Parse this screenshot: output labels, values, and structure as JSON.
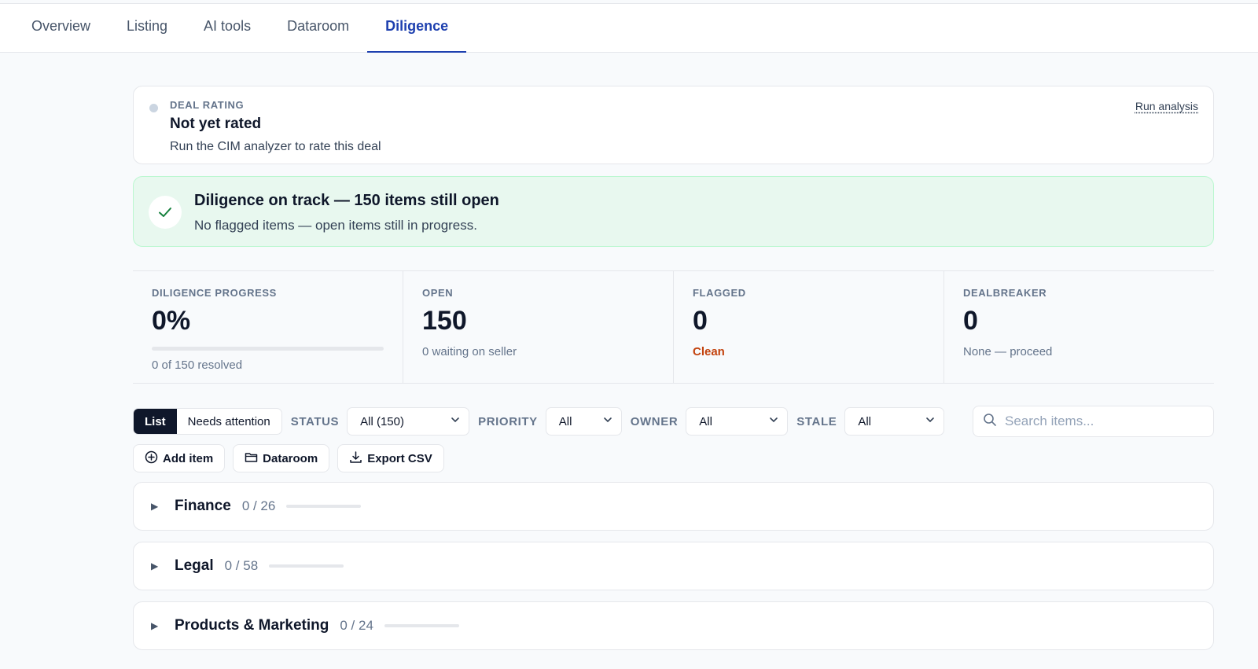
{
  "tabs": [
    {
      "label": "Overview",
      "active": false
    },
    {
      "label": "Listing",
      "active": false
    },
    {
      "label": "AI tools",
      "active": false
    },
    {
      "label": "Dataroom",
      "active": false
    },
    {
      "label": "Diligence",
      "active": true
    }
  ],
  "rating": {
    "eyebrow": "DEAL RATING",
    "title": "Not yet rated",
    "subtitle": "Run the CIM analyzer to rate this deal",
    "action": "Run analysis"
  },
  "banner": {
    "title": "Diligence on track — 150 items still open",
    "subtitle": "No flagged items — open items still in progress.",
    "icon": "check-icon"
  },
  "stats": [
    {
      "label": "DILIGENCE PROGRESS",
      "value": "0%",
      "note": "0 of 150 resolved",
      "progress": 0
    },
    {
      "label": "OPEN",
      "value": "150",
      "note": "0 waiting on seller"
    },
    {
      "label": "FLAGGED",
      "value": "0",
      "note": "Clean"
    },
    {
      "label": "DEALBREAKER",
      "value": "0",
      "note": "None — proceed"
    }
  ],
  "filters": {
    "view_list": "List",
    "view_attention": "Needs attention",
    "status_label": "STATUS",
    "status_value": "All (150)",
    "priority_label": "PRIORITY",
    "priority_value": "All",
    "owner_label": "OWNER",
    "owner_value": "All",
    "stale_label": "STALE",
    "stale_value": "All",
    "search_placeholder": "Search items..."
  },
  "actions": {
    "add_item": "Add item",
    "dataroom": "Dataroom",
    "export_csv": "Export CSV"
  },
  "sections": [
    {
      "name": "Finance",
      "count": "0 / 26",
      "progress": 0
    },
    {
      "name": "Legal",
      "count": "0 / 58",
      "progress": 0
    },
    {
      "name": "Products & Marketing",
      "count": "0 / 24",
      "progress": 0
    }
  ],
  "colors": {
    "accent": "#1e40af",
    "success_bg": "#e8f8ef",
    "warn": "#c2410c"
  }
}
